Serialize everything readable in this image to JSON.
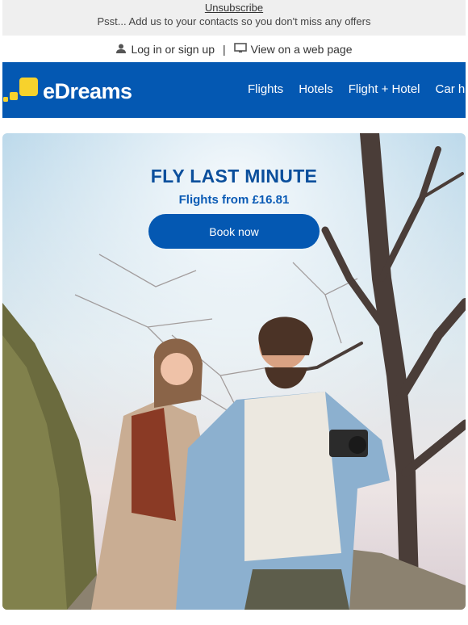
{
  "header": {
    "unsubscribe": "Unsubscribe",
    "psst": "Psst... Add us to your contacts so you don't miss any offers",
    "login": "Log in or sign up",
    "separator": "|",
    "web_view": "View on a web page"
  },
  "nav": {
    "logo_text": "eDreams",
    "links": [
      "Flights",
      "Hotels",
      "Flight + Hotel",
      "Car hire"
    ],
    "brand_color": "#0458b2",
    "logo_color": "#f7d22c"
  },
  "hero": {
    "title": "FLY LAST MINUTE",
    "subtitle": "Flights from £16.81",
    "cta": "Book now"
  }
}
